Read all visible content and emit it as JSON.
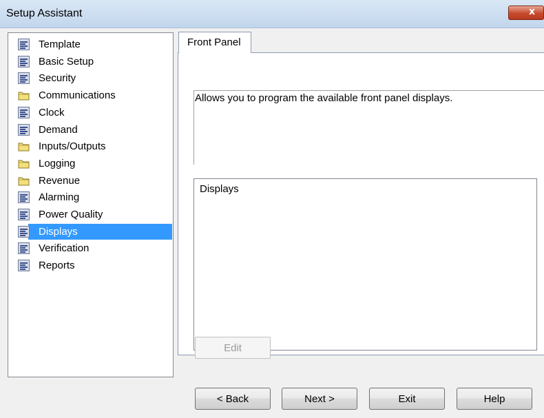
{
  "window": {
    "title": "Setup Assistant",
    "close_glyph": "x"
  },
  "tree": {
    "selected": "Displays",
    "items": [
      {
        "label": "Template",
        "icon": "document-icon"
      },
      {
        "label": "Basic Setup",
        "icon": "document-icon"
      },
      {
        "label": "Security",
        "icon": "document-icon"
      },
      {
        "label": "Communications",
        "icon": "folder-icon"
      },
      {
        "label": "Clock",
        "icon": "document-icon"
      },
      {
        "label": "Demand",
        "icon": "document-icon"
      },
      {
        "label": "Inputs/Outputs",
        "icon": "folder-icon"
      },
      {
        "label": "Logging",
        "icon": "folder-icon"
      },
      {
        "label": "Revenue",
        "icon": "folder-icon"
      },
      {
        "label": "Alarming",
        "icon": "document-icon"
      },
      {
        "label": "Power Quality",
        "icon": "document-icon"
      },
      {
        "label": "Displays",
        "icon": "document-icon"
      },
      {
        "label": "Verification",
        "icon": "document-icon"
      },
      {
        "label": "Reports",
        "icon": "document-icon"
      }
    ]
  },
  "tab": {
    "label": "Front Panel"
  },
  "panel": {
    "description": "Allows you to program the available front panel displays.",
    "list_items": [
      "Displays"
    ],
    "edit_label": "Edit"
  },
  "buttons": {
    "back": "< Back",
    "next": "Next >",
    "exit": "Exit",
    "help": "Help"
  },
  "colors": {
    "selection": "#3399ff",
    "folder": "#f3e07a"
  }
}
